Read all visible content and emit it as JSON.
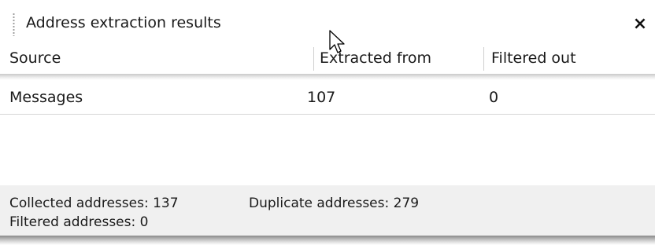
{
  "panel": {
    "title": "Address extraction results",
    "close_label": "×"
  },
  "table": {
    "columns": [
      "Source",
      "Extracted from",
      "Filtered out"
    ],
    "rows": [
      {
        "source": "Messages",
        "extracted_from": "107",
        "filtered_out": "0"
      }
    ]
  },
  "status": {
    "collected": "Collected addresses: 137",
    "duplicate": "Duplicate addresses: 279",
    "filtered": "Filtered addresses:  0"
  },
  "icons": {
    "grip": "grip-icon",
    "close": "close-icon",
    "cursor": "mouse-cursor-icon"
  }
}
